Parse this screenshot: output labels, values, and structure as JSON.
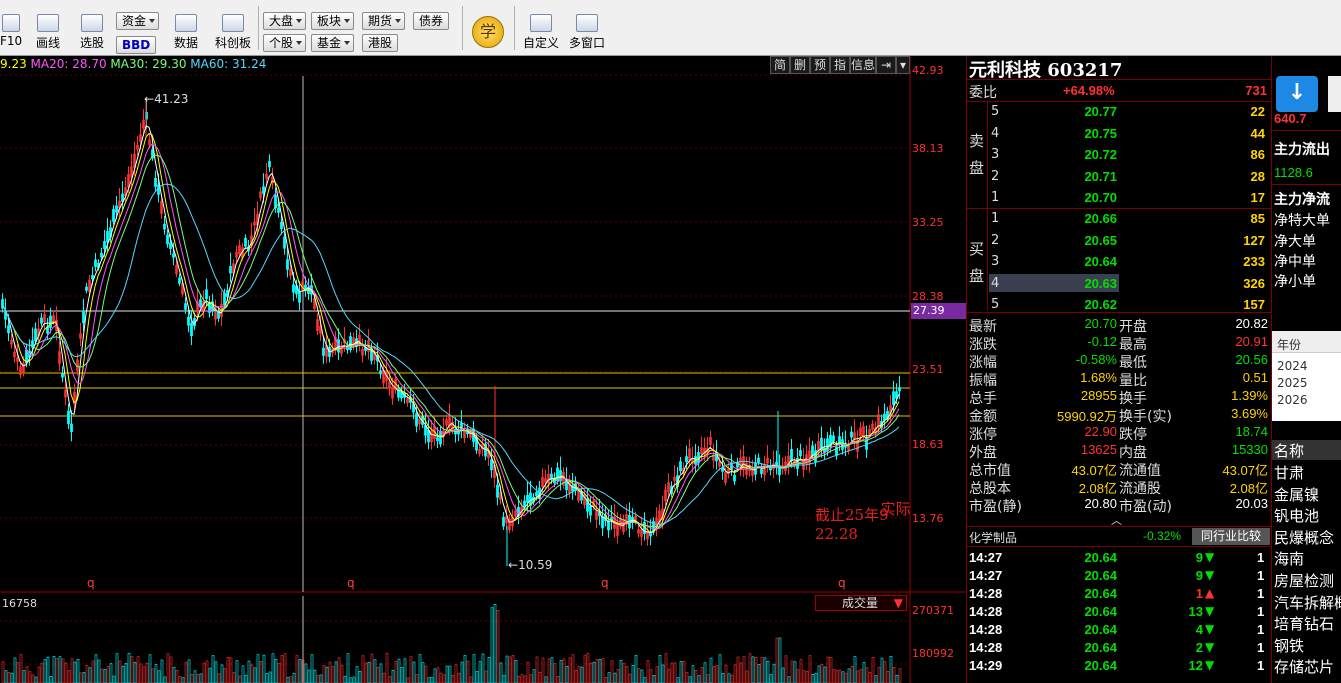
{
  "toolbar": {
    "buttons": [
      {
        "label": "F10"
      },
      {
        "label": "画线"
      },
      {
        "label": "选股"
      },
      {
        "label": "资金"
      },
      {
        "label": "BBD"
      },
      {
        "label": "数据"
      },
      {
        "label": "科创板"
      },
      {
        "label": "大盘"
      },
      {
        "label": "板块"
      },
      {
        "label": "期货"
      },
      {
        "label": "债券"
      },
      {
        "label": "个股"
      },
      {
        "label": "基金"
      },
      {
        "label": "港股"
      },
      {
        "label": "学"
      },
      {
        "label": "自定义"
      },
      {
        "label": "多窗口"
      }
    ]
  },
  "chart": {
    "ma_legend": [
      {
        "text": "9.23",
        "color": "#ffff00"
      },
      {
        "text": "MA20: 28.70",
        "color": "#ff55ff"
      },
      {
        "text": "MA30: 29.30",
        "color": "#77ff77"
      },
      {
        "text": "MA60: 31.24",
        "color": "#55d7ff"
      }
    ],
    "tabs": [
      "简",
      "删",
      "预",
      "指",
      "信息",
      "⇥"
    ],
    "price_labels": [
      "42.93",
      "38.13",
      "33.25",
      "28.38",
      "23.51",
      "18.63",
      "13.76"
    ],
    "current_price_label": "27.39",
    "max_label": "41.23",
    "min_label": "10.59",
    "q_markers": [
      "q",
      "q",
      "q",
      "q"
    ],
    "annotation_line1": "截止25年9",
    "annotation_line1b": "实际",
    "annotation_line2": "22.28",
    "volume": {
      "left_value": "16758",
      "selector": "成交量",
      "axis": [
        "270371",
        "180992"
      ]
    }
  },
  "quote": {
    "title": "元利科技 603217",
    "webi_label": "委比",
    "webi_value": "+64.98%",
    "webi_diff": "731",
    "sell_label": "卖盘",
    "buy_label": "买盘",
    "asks": [
      {
        "level": "5",
        "price": "20.77",
        "vol": "22"
      },
      {
        "level": "4",
        "price": "20.75",
        "vol": "44"
      },
      {
        "level": "3",
        "price": "20.72",
        "vol": "86"
      },
      {
        "level": "2",
        "price": "20.71",
        "vol": "28"
      },
      {
        "level": "1",
        "price": "20.70",
        "vol": "17"
      }
    ],
    "bids": [
      {
        "level": "1",
        "price": "20.66",
        "vol": "85"
      },
      {
        "level": "2",
        "price": "20.65",
        "vol": "127"
      },
      {
        "level": "3",
        "price": "20.64",
        "vol": "233"
      },
      {
        "level": "4",
        "price": "20.63",
        "vol": "326"
      },
      {
        "level": "5",
        "price": "20.62",
        "vol": "157"
      }
    ],
    "stats": [
      {
        "l1": "最新",
        "v1": "20.70",
        "c1": "grn",
        "l2": "开盘",
        "v2": "20.82",
        "c2": "wht"
      },
      {
        "l1": "涨跌",
        "v1": "-0.12",
        "c1": "grn",
        "l2": "最高",
        "v2": "20.91",
        "c2": "red"
      },
      {
        "l1": "涨幅",
        "v1": "-0.58%",
        "c1": "grn",
        "l2": "最低",
        "v2": "20.56",
        "c2": "grn"
      },
      {
        "l1": "振幅",
        "v1": "1.68%",
        "c1": "yel",
        "l2": "量比",
        "v2": "0.51",
        "c2": "yel"
      },
      {
        "l1": "总手",
        "v1": "28955",
        "c1": "yel",
        "l2": "换手",
        "v2": "1.39%",
        "c2": "yel"
      },
      {
        "l1": "金额",
        "v1": "5990.92万",
        "c1": "yel",
        "l2": "换手(实)",
        "v2": "3.69%",
        "c2": "yel"
      },
      {
        "l1": "涨停",
        "v1": "22.90",
        "c1": "red",
        "l2": "跌停",
        "v2": "18.74",
        "c2": "grn"
      },
      {
        "l1": "外盘",
        "v1": "13625",
        "c1": "red",
        "l2": "内盘",
        "v2": "15330",
        "c2": "grn"
      },
      {
        "l1": "总市值",
        "v1": "43.07亿",
        "c1": "yel",
        "l2": "流通值",
        "v2": "43.07亿",
        "c2": "yel"
      },
      {
        "l1": "总股本",
        "v1": "2.08亿",
        "c1": "yel",
        "l2": "流通股",
        "v2": "2.08亿",
        "c2": "yel"
      },
      {
        "l1": "市盈(静)",
        "v1": "20.80",
        "c1": "wht",
        "l2": "市盈(动)",
        "v2": "20.03",
        "c2": "wht"
      }
    ],
    "industry_name": "化学制品",
    "industry_change": "-0.32%",
    "industry_button": "同行业比较",
    "ticks": [
      {
        "time": "14:27",
        "price": "20.64",
        "vol": "9",
        "dir": "down",
        "extra": "1"
      },
      {
        "time": "14:27",
        "price": "20.64",
        "vol": "9",
        "dir": "down",
        "extra": "1"
      },
      {
        "time": "14:28",
        "price": "20.64",
        "vol": "1",
        "dir": "up",
        "extra": "1"
      },
      {
        "time": "14:28",
        "price": "20.64",
        "vol": "13",
        "dir": "down",
        "extra": "1"
      },
      {
        "time": "14:28",
        "price": "20.64",
        "vol": "4",
        "dir": "down",
        "extra": "1"
      },
      {
        "time": "14:28",
        "price": "20.64",
        "vol": "2",
        "dir": "down",
        "extra": "1"
      },
      {
        "time": "14:29",
        "price": "20.64",
        "vol": "12",
        "dir": "down",
        "extra": "1"
      }
    ]
  },
  "fund_panel": {
    "value_1": "640.7",
    "heading_1": "主力流出",
    "value_2": "1128.6",
    "heading_2": "主力净流",
    "rows": [
      "净特大单",
      "净大单",
      "净中单",
      "净小单"
    ],
    "year_label": "年份",
    "years": [
      "2024",
      "2025",
      "2026"
    ],
    "concept_header": "名称",
    "concepts": [
      "甘肃",
      "金属镍",
      "钒电池",
      "民爆概念",
      "海南",
      "房屋检测",
      "汽车拆解概",
      "培育钻石",
      "钢铁",
      "存储芯片"
    ]
  }
}
